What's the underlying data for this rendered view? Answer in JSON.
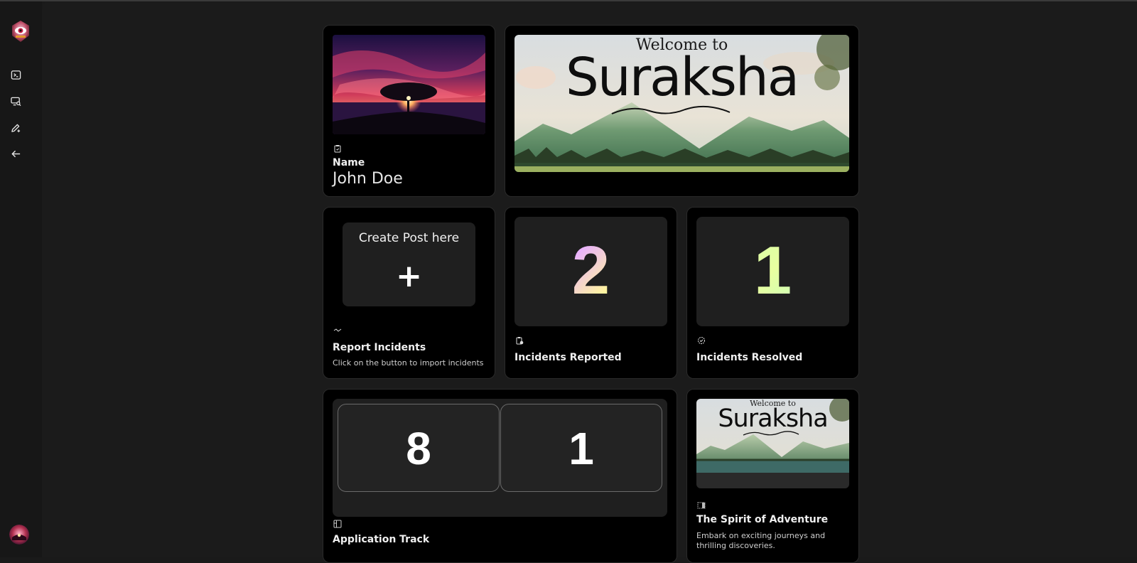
{
  "sidebar": {
    "logo_icon": "eye-logo-icon",
    "nav": [
      {
        "icon": "terminal-icon",
        "label": "Terminal"
      },
      {
        "icon": "screen-search-icon",
        "label": "Search"
      },
      {
        "icon": "pen-plus-icon",
        "label": "Create"
      },
      {
        "icon": "arrow-left-icon",
        "label": "Back"
      }
    ],
    "avatar_icon": "user-avatar-icon"
  },
  "profile": {
    "label": "Name",
    "name": "John Doe"
  },
  "banner": {
    "line1": "Welcome to",
    "line2": "Suraksha"
  },
  "create_post": {
    "button_label": "Create Post here",
    "plus": "+",
    "title": "Report Incidents",
    "description": "Click on the button to import incidents"
  },
  "incidents_reported": {
    "value": "2",
    "title": "Incidents Reported"
  },
  "incidents_resolved": {
    "value": "1",
    "title": "Incidents Resolved"
  },
  "application_track": {
    "values": [
      "8",
      "1"
    ],
    "title": "Application Track"
  },
  "adventure": {
    "banner_line1": "Welcome to",
    "banner_line2": "Suraksha",
    "title": "The Spirit of Adventure",
    "description": "Embark on exciting journeys and thrilling discoveries."
  },
  "colors": {
    "background": "#1b1b1b",
    "card": "#000000",
    "inner": "#1f1f1f"
  }
}
